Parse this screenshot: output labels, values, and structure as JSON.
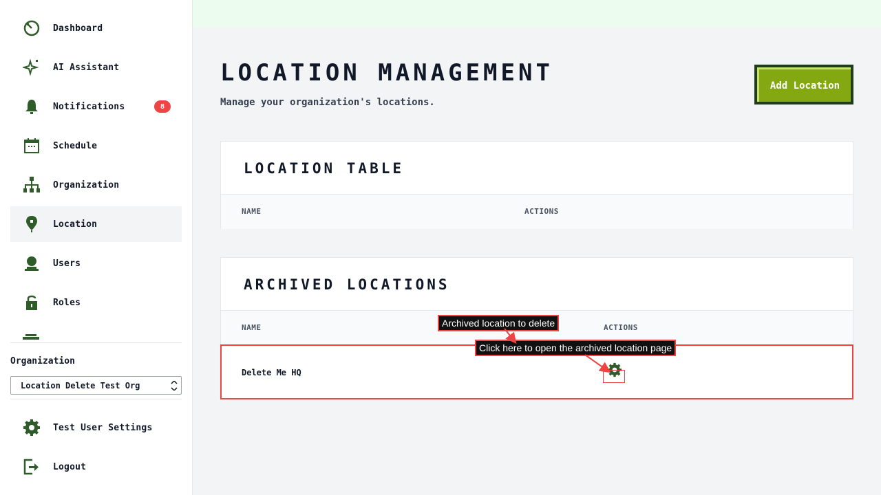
{
  "sidebar": {
    "items": [
      {
        "label": "Dashboard",
        "icon": "dashboard-icon"
      },
      {
        "label": "AI Assistant",
        "icon": "sparkle-icon"
      },
      {
        "label": "Notifications",
        "icon": "bell-icon",
        "badge": "8"
      },
      {
        "label": "Schedule",
        "icon": "calendar-icon"
      },
      {
        "label": "Organization",
        "icon": "org-chart-icon"
      },
      {
        "label": "Location",
        "icon": "map-pin-icon",
        "active": true
      },
      {
        "label": "Users",
        "icon": "user-icon"
      },
      {
        "label": "Roles",
        "icon": "lock-icon"
      }
    ],
    "org_label": "Organization",
    "org_select_value": "Location Delete Test Org",
    "footer": [
      {
        "label": "Test User Settings",
        "icon": "gear-icon"
      },
      {
        "label": "Logout",
        "icon": "logout-icon"
      }
    ]
  },
  "header": {
    "title": "Location Management",
    "subtitle": "Manage your organization's locations.",
    "add_button": "Add Location"
  },
  "location_table": {
    "title": "Location Table",
    "columns": [
      "Name",
      "Actions"
    ]
  },
  "archived_table": {
    "title": "Archived Locations",
    "columns": [
      "Name",
      "Actions"
    ],
    "rows": [
      {
        "name": "Delete Me HQ"
      }
    ]
  },
  "annotations": {
    "archived_label": "Archived location to delete",
    "click_label": "Click here to open the archived location page"
  },
  "colors": {
    "accent_green": "#84a812",
    "icon_green": "#2f5d2a",
    "badge_red": "#ef4444",
    "annotation_red": "#ef4444"
  }
}
